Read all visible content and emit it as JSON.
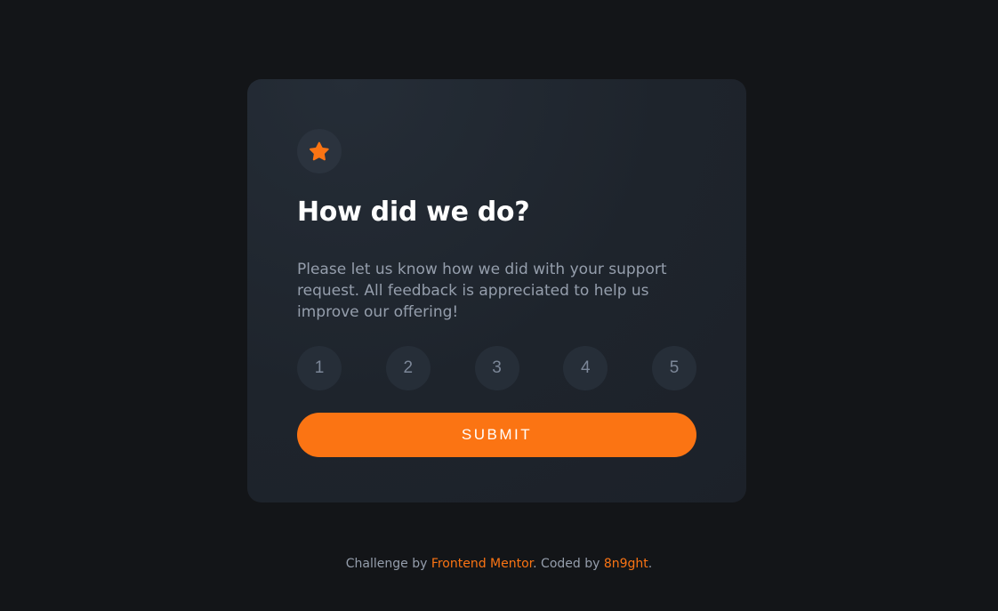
{
  "colors": {
    "page_background": "#131518",
    "card_background": "#212830",
    "accent": "#fb7413",
    "heading": "#ffffff",
    "body_text": "#959eac",
    "rating_background": "#262e38",
    "rating_text": "#7c8798"
  },
  "card": {
    "icon": "star-icon",
    "title": "How did we do?",
    "description": "Please let us know how we did with your support request. All feedback is appreciated to help us improve our offering!",
    "ratings": [
      "1",
      "2",
      "3",
      "4",
      "5"
    ],
    "submit_label": "SUBMIT"
  },
  "attribution": {
    "prefix": "Challenge by ",
    "link1_label": "Frontend Mentor",
    "middle": ". Coded by ",
    "link2_label": "8n9ght",
    "suffix": "."
  }
}
